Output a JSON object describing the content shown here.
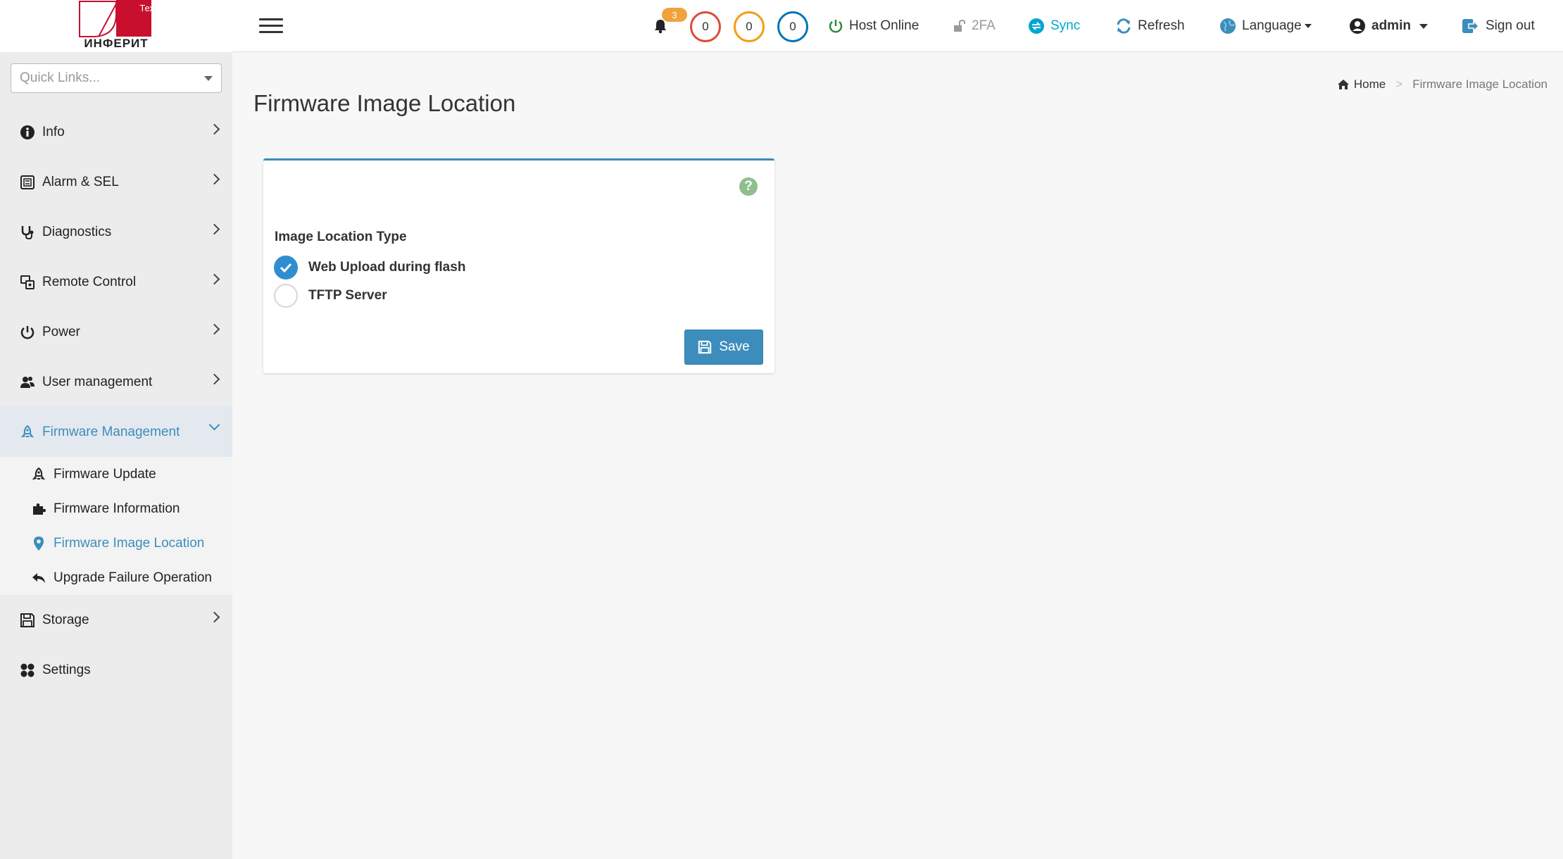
{
  "brand": {
    "logo_text": "ИНФЕРИТ",
    "logo_tag": "Тех",
    "accent_red": "#c8102e"
  },
  "sidebar": {
    "quick_links_placeholder": "Quick Links...",
    "items": [
      {
        "label": "Info",
        "icon": "info-circle-icon"
      },
      {
        "label": "Alarm & SEL",
        "icon": "alarm-list-icon"
      },
      {
        "label": "Diagnostics",
        "icon": "stethoscope-icon"
      },
      {
        "label": "Remote Control",
        "icon": "remote-control-icon"
      },
      {
        "label": "Power",
        "icon": "power-icon"
      },
      {
        "label": "User management",
        "icon": "users-icon"
      },
      {
        "label": "Firmware Management",
        "icon": "rocket-icon",
        "expanded": true
      }
    ],
    "sub_items": [
      {
        "label": "Firmware Update",
        "icon": "rocket-icon"
      },
      {
        "label": "Firmware Information",
        "icon": "puzzle-icon"
      },
      {
        "label": "Firmware Image Location",
        "icon": "map-marker-icon",
        "active": true
      },
      {
        "label": "Upgrade Failure Operation",
        "icon": "reply-icon"
      }
    ],
    "items_after": [
      {
        "label": "Storage",
        "icon": "floppy-icon"
      },
      {
        "label": "Settings",
        "icon": "settings-grid-icon"
      }
    ]
  },
  "header": {
    "notification_count": "3",
    "critical_count": "0",
    "warning_count": "0",
    "info_count": "0",
    "host_status": "Host Online",
    "twofa": "2FA",
    "sync": "Sync",
    "refresh": "Refresh",
    "language": "Language",
    "user": "admin",
    "sign_out": "Sign out",
    "colors": {
      "critical": "#dd4b39",
      "warning": "#f39c12",
      "info": "#0073b7",
      "online": "#2e8b3a",
      "sync": "#00a7d0"
    }
  },
  "page": {
    "title": "Firmware Image Location",
    "breadcrumb": {
      "home": "Home",
      "current": "Firmware Image Location"
    }
  },
  "form": {
    "field_label": "Image Location Type",
    "options": [
      {
        "label": "Web Upload during flash",
        "checked": true
      },
      {
        "label": "TFTP Server",
        "checked": false
      }
    ],
    "save_label": "Save"
  }
}
